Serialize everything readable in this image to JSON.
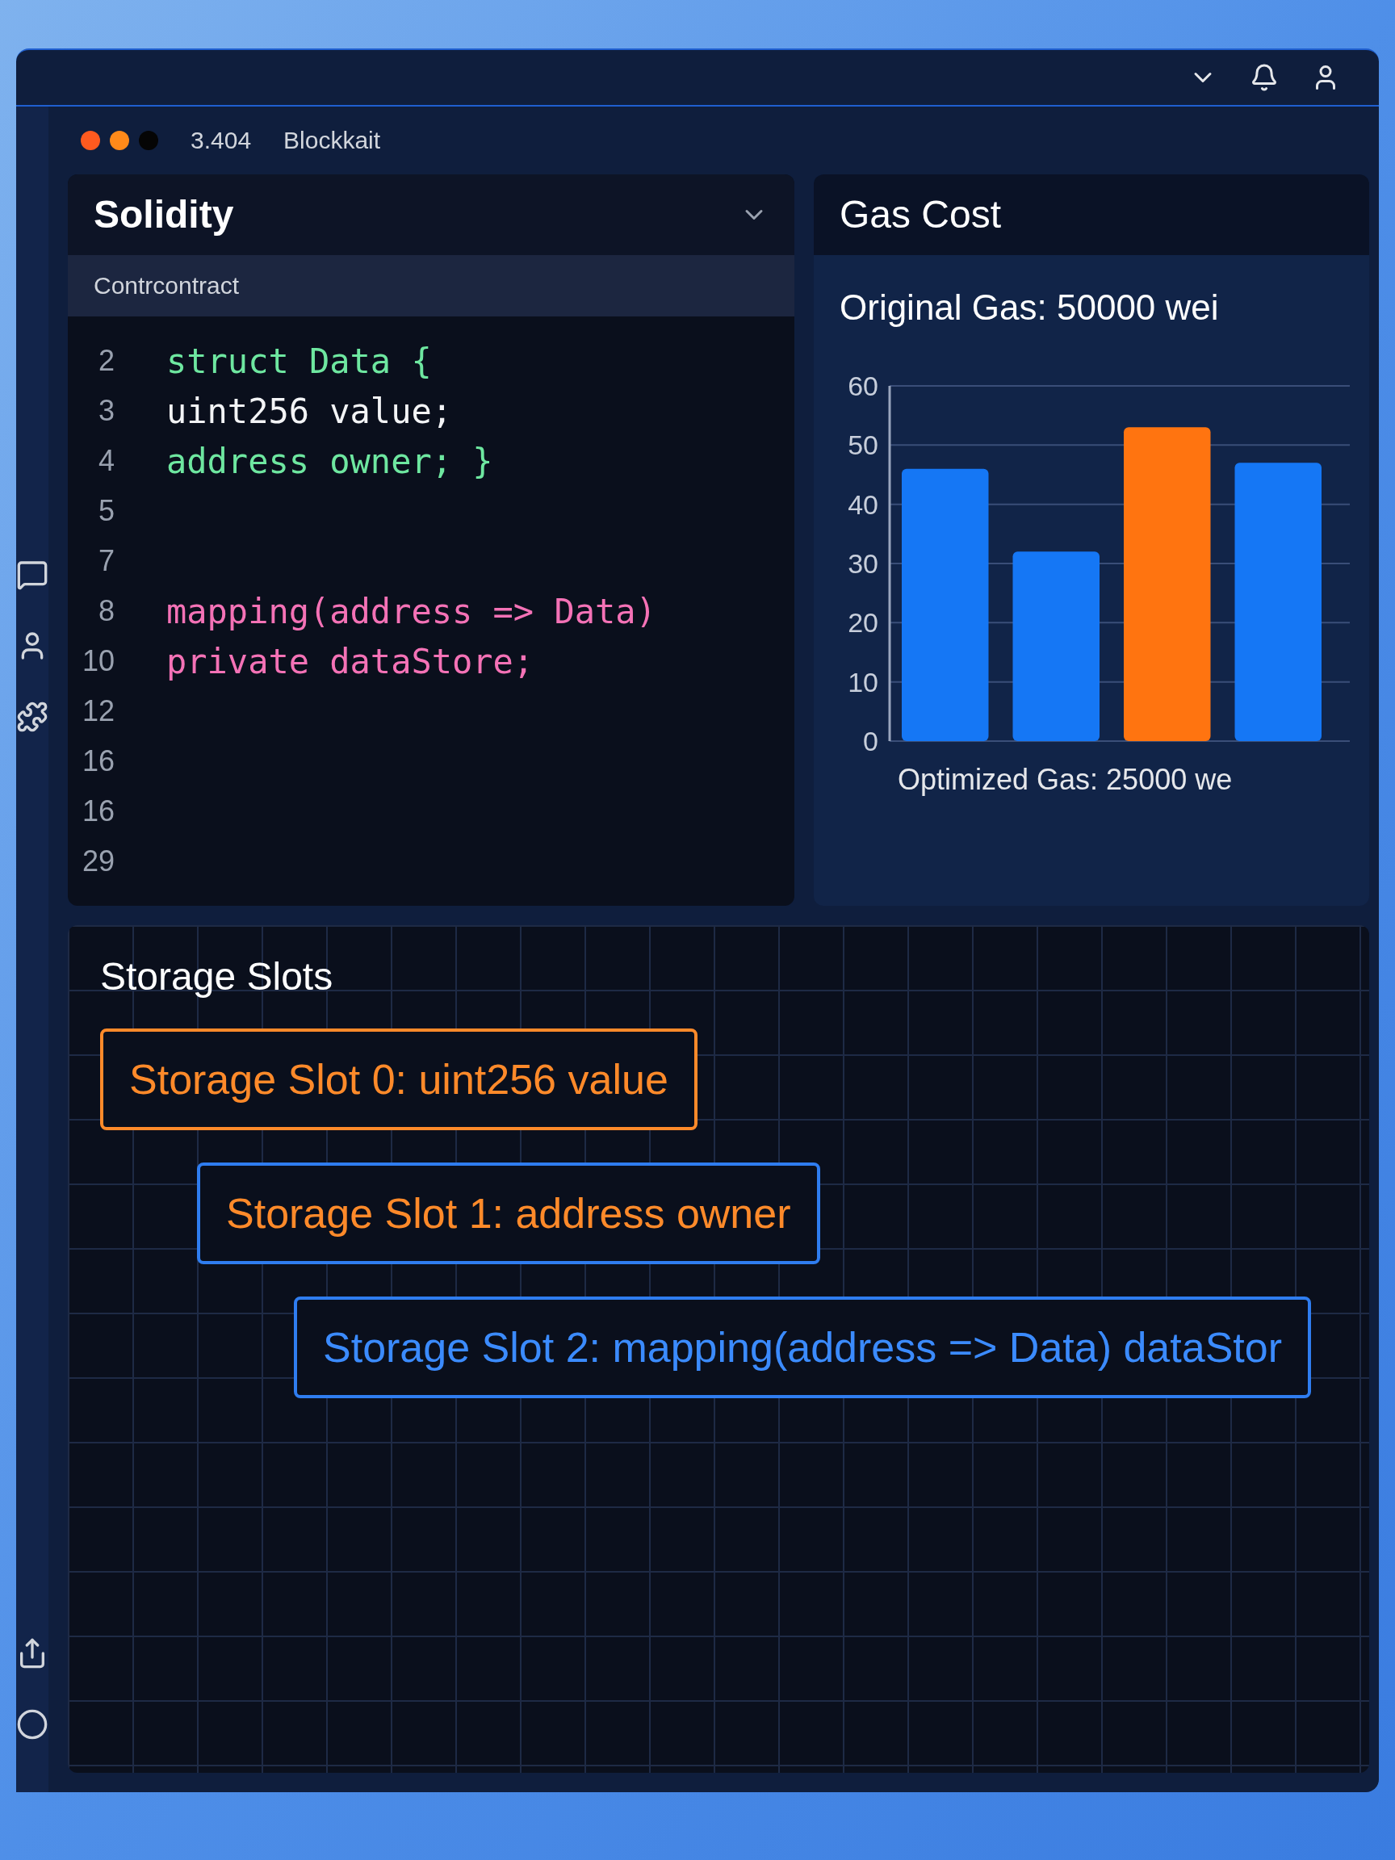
{
  "window": {
    "version": "3.404",
    "title": "Blockkait",
    "traffic_lights": [
      {
        "color": "#ff5a1f"
      },
      {
        "color": "#ff8a1a"
      },
      {
        "color": "#050505"
      }
    ]
  },
  "editor": {
    "language": "Solidity",
    "tab": "Contrcontract",
    "lines": [
      {
        "number": "2",
        "text": "struct Data {",
        "color": "#6ee7a0"
      },
      {
        "number": "3",
        "text": "uint256 value;",
        "color": "#f3f4f6"
      },
      {
        "number": "4",
        "text": "address owner; }",
        "color": "#6ee7a0"
      },
      {
        "number": "5"
      },
      {
        "number": "7"
      },
      {
        "number": "8",
        "text": "mapping(address => Data)",
        "color": "#f472b6"
      },
      {
        "number": "10",
        "text": "private dataStore;",
        "color": "#f472b6"
      },
      {
        "number": "12"
      },
      {
        "number": "16"
      },
      {
        "number": "16"
      },
      {
        "number": "29"
      }
    ]
  },
  "gas_cost": {
    "title": "Gas Cost",
    "original": "Original Gas: 50000 wei",
    "chart_data": {
      "type": "bar",
      "xlabel": "Optimized Gas: 25000 we",
      "stacked": true,
      "grid": true,
      "ylim": [
        0,
        60
      ],
      "yticks": [
        0,
        10,
        20,
        30,
        40,
        50,
        60
      ],
      "series": [
        {
          "color": "#1577f5",
          "values": [
            46,
            32,
            null,
            47
          ]
        },
        {
          "color": "#ff7410",
          "values": [
            null,
            null,
            53,
            null
          ]
        }
      ]
    }
  },
  "storage": {
    "title": "Storage Slots",
    "slots": [
      {
        "text": "Storage Slot 0: uint256 value",
        "color": "#ff8a2a",
        "kind": "highlighted"
      },
      {
        "text": "Storage Slot 1: address owner",
        "color": "#ff8a2a",
        "kind": "normal"
      },
      {
        "text": "Storage Slot 2: mapping(address => Data) dataStor",
        "color": "#3b8bff",
        "kind": "normal"
      }
    ]
  }
}
